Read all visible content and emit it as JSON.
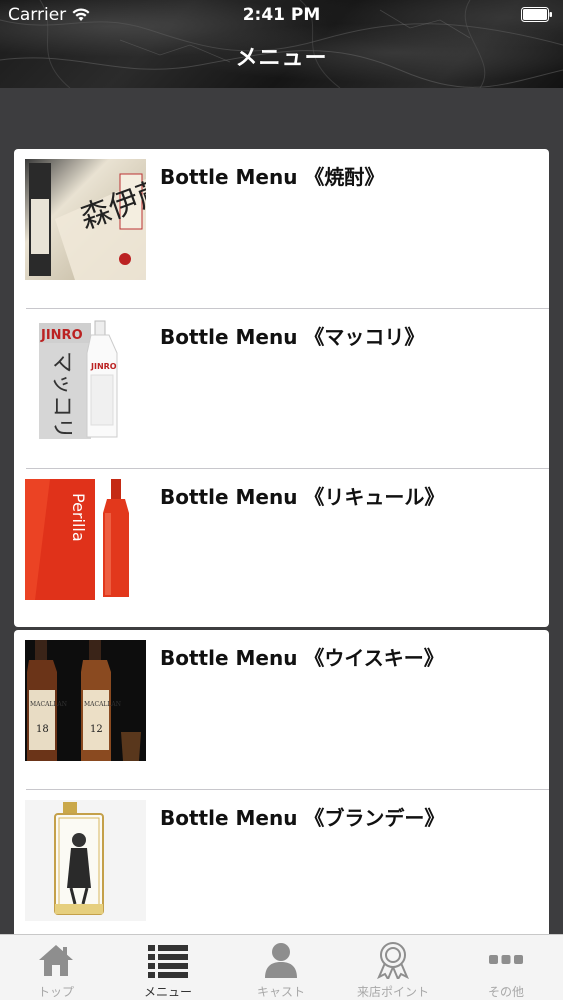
{
  "status_bar": {
    "carrier": "Carrier",
    "time": "2:41 PM"
  },
  "nav": {
    "title": "メニュー"
  },
  "menu_items": [
    {
      "label": "Bottle Menu 《焼酎》",
      "image": "shochu-bottle-image"
    },
    {
      "label": "Bottle Menu 《マッコリ》",
      "image": "makgeolli-bottle-image"
    },
    {
      "label": "Bottle Menu 《リキュール》",
      "image": "liqueur-bottle-image"
    },
    {
      "label": "Bottle Menu 《ウイスキー》",
      "image": "whisky-bottle-image"
    },
    {
      "label": "Bottle Menu 《ブランデー》",
      "image": "brandy-bottle-image"
    }
  ],
  "tabs": [
    {
      "label": "トップ",
      "icon": "home-icon",
      "active": false
    },
    {
      "label": "メニュー",
      "icon": "list-icon",
      "active": true
    },
    {
      "label": "キャスト",
      "icon": "person-icon",
      "active": false
    },
    {
      "label": "来店ポイント",
      "icon": "award-ribbon-icon",
      "active": false
    },
    {
      "label": "その他",
      "icon": "more-icon",
      "active": false
    }
  ],
  "thumb_text": {
    "shochu": "森伊蔵",
    "makgeolli_brand": "JINRO",
    "makgeolli_name": "マッコリ",
    "liqueur": "Perilla",
    "whisky_brand": "MACALLAN",
    "whisky_age_1": "18",
    "whisky_age_2": "12"
  },
  "colors": {
    "header_bg": "#1e1e1e",
    "content_bg": "#3d3d3f",
    "card_bg": "#ffffff",
    "tab_active": "#333333",
    "tab_inactive": "#a8a8a8"
  }
}
